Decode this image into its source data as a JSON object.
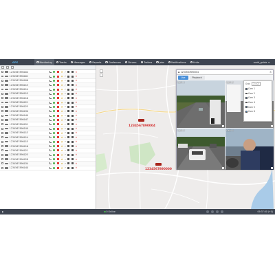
{
  "topbar": {
    "logo_text": "GPS",
    "tabs": [
      {
        "label": "Monitoring",
        "active": true
      },
      {
        "label": "Tracks"
      },
      {
        "label": "Messages"
      },
      {
        "label": "Reports"
      },
      {
        "label": "Geofences"
      },
      {
        "label": "Drivers"
      },
      {
        "label": "Trailers"
      },
      {
        "label": "Jobs"
      },
      {
        "label": "Notifications"
      },
      {
        "label": "Units"
      }
    ],
    "user": "scott_guide"
  },
  "sidebar": {
    "vehicles": [
      "1234567890004",
      "1234567890001",
      "1234567890006",
      "1234567890013",
      "1234567890014",
      "1234567890015",
      "1234567890016",
      "1234567890021",
      "1234567890025",
      "1234567890030",
      "1234567890040",
      "1234567890047",
      "1234567890051",
      "1234567890100",
      "1234567890013",
      "1234567890014",
      "1234567890015",
      "1234567890016",
      "1234567890021",
      "1234567890025",
      "1234567890028",
      "1234567890034",
      "1234567890040"
    ]
  },
  "map": {
    "labels": [
      "1234567890004",
      "1234567890000"
    ]
  },
  "video": {
    "title": "1234567890004",
    "tabs": [
      "Live",
      "Playback"
    ],
    "cams": [
      "Cam 1",
      "Cam 2",
      "Cam 3",
      "Cam 4"
    ],
    "grid_label": "Grid",
    "grid_value": "2 x 2",
    "cam_options": [
      "Cam 1",
      "Cam 2",
      "Cam 3",
      "Cam 4",
      "Cam 5",
      "Cam 6"
    ]
  },
  "statusbar": {
    "center_text": "0 Online",
    "time": "09:37:00 (+0)"
  }
}
